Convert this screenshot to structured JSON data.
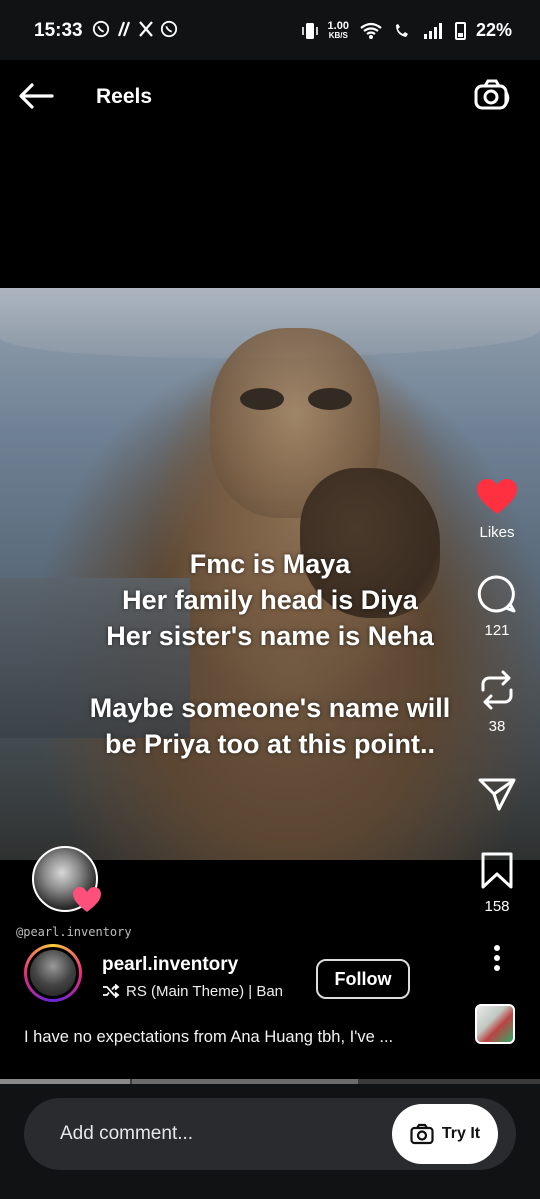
{
  "status_bar": {
    "time": "15:33",
    "left_icons": [
      "whatsapp-icon",
      "slash-icon",
      "x-icon",
      "whatsapp-icon"
    ],
    "net_speed": "1.00",
    "net_unit": "KB/S",
    "battery": "22%"
  },
  "header": {
    "title": "Reels"
  },
  "media": {
    "caption_lines_top": [
      "Fmc is Maya",
      "Her family head is Diya",
      "Her sister's name is Neha"
    ],
    "caption_lines_bottom": [
      "Maybe someone's name will",
      "be Priya too at this point.."
    ]
  },
  "rail": {
    "likes_label": "Likes",
    "comments_count": "121",
    "reposts_count": "38",
    "saves_count": "158"
  },
  "overlay": {
    "watermark": "@pearl.inventory"
  },
  "author": {
    "username": "pearl.inventory",
    "music_text": "RS  (Main Theme)  |  Ban",
    "follow_label": "Follow"
  },
  "caption": {
    "text": "I have no expectations from Ana Huang tbh, I've ..."
  },
  "progress": {
    "fraction": 0.24
  },
  "comment_bar": {
    "placeholder": "Add comment...",
    "try_it_label": "Try It"
  },
  "colors": {
    "like_red": "#ff3040",
    "background": "#000000"
  }
}
